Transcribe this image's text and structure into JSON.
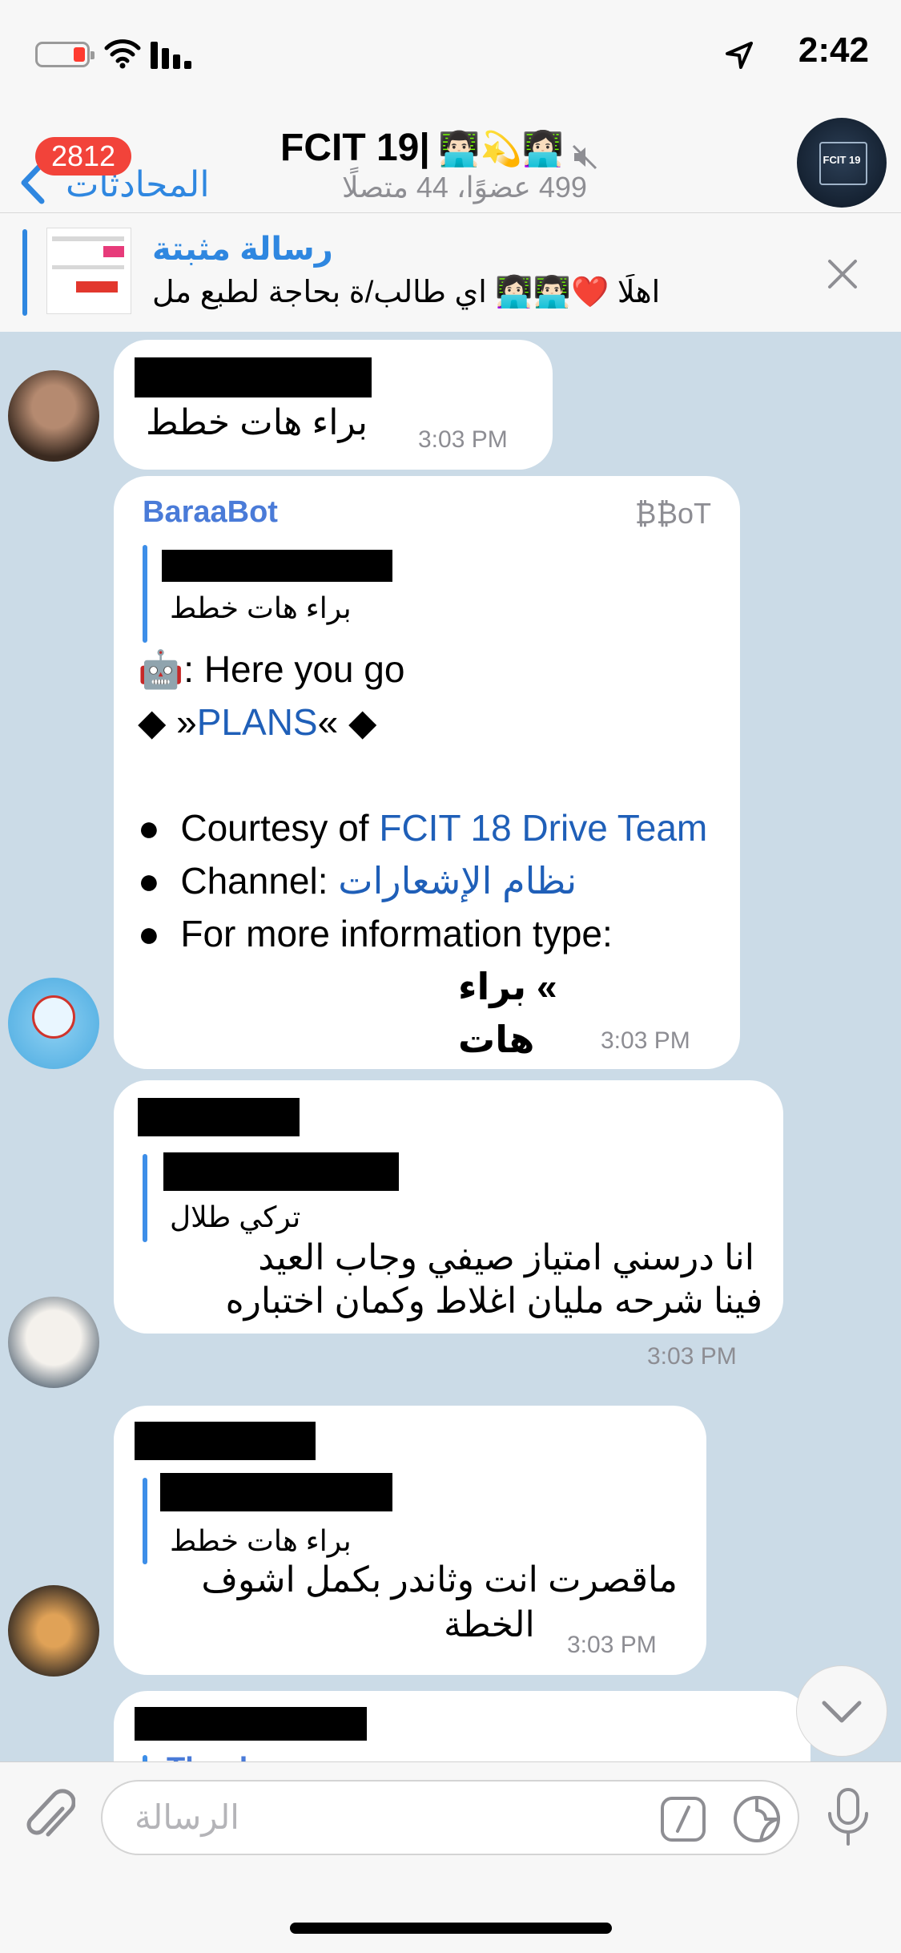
{
  "status": {
    "time": "2:42"
  },
  "header": {
    "back_label": "المحادثات",
    "unread_badge": "2812",
    "title": "FCIT 19|",
    "title_emoji": "👨🏻‍💻💫👩🏻‍💻",
    "subtitle": "499 عضوًا، 44 متصلًا",
    "group_avatar_text": "FCIT 19"
  },
  "pinned": {
    "title": "رسالة مثبتة",
    "preview": "اهلًا ❤️👨🏻‍💻👩🏻‍💻 اي طالب/ة بحاجة لطبع مل"
  },
  "messages": [
    {
      "text": "براء هات خطط",
      "time": "3:03 PM"
    },
    {
      "sender": "BaraaBot",
      "badge": "₿₿oT",
      "reply_quote": "براء هات خطط",
      "line1": "🤖: Here you go",
      "plans_prefix": "◆ »",
      "plans_link": "PLANS",
      "plans_suffix": "« ◆",
      "courtesy_label": "Courtesy of ",
      "courtesy_link": "FCIT 18 Drive Team",
      "channel_label": "Channel: ",
      "channel_link": "نظام الإشعارات",
      "info_label": "For more information type:",
      "info_cmd": "» براء هات",
      "bullet": "●",
      "time": "3:03 PM"
    },
    {
      "reply_quote": "تركي طلال",
      "line1": "انا درسني امتياز صيفي وجاب العيد",
      "line2": "فينا شرحه مليان اغلاط وكمان اختباره",
      "time": "3:03 PM"
    },
    {
      "reply_quote": "براء هات خطط",
      "line1": "ماقصرت انت وثاندر بكمل اشوف",
      "line2": "الخطة",
      "time": "3:03 PM"
    },
    {
      "reply_quote_partial": "Thanks"
    }
  ],
  "input": {
    "placeholder": "الرسالة"
  }
}
